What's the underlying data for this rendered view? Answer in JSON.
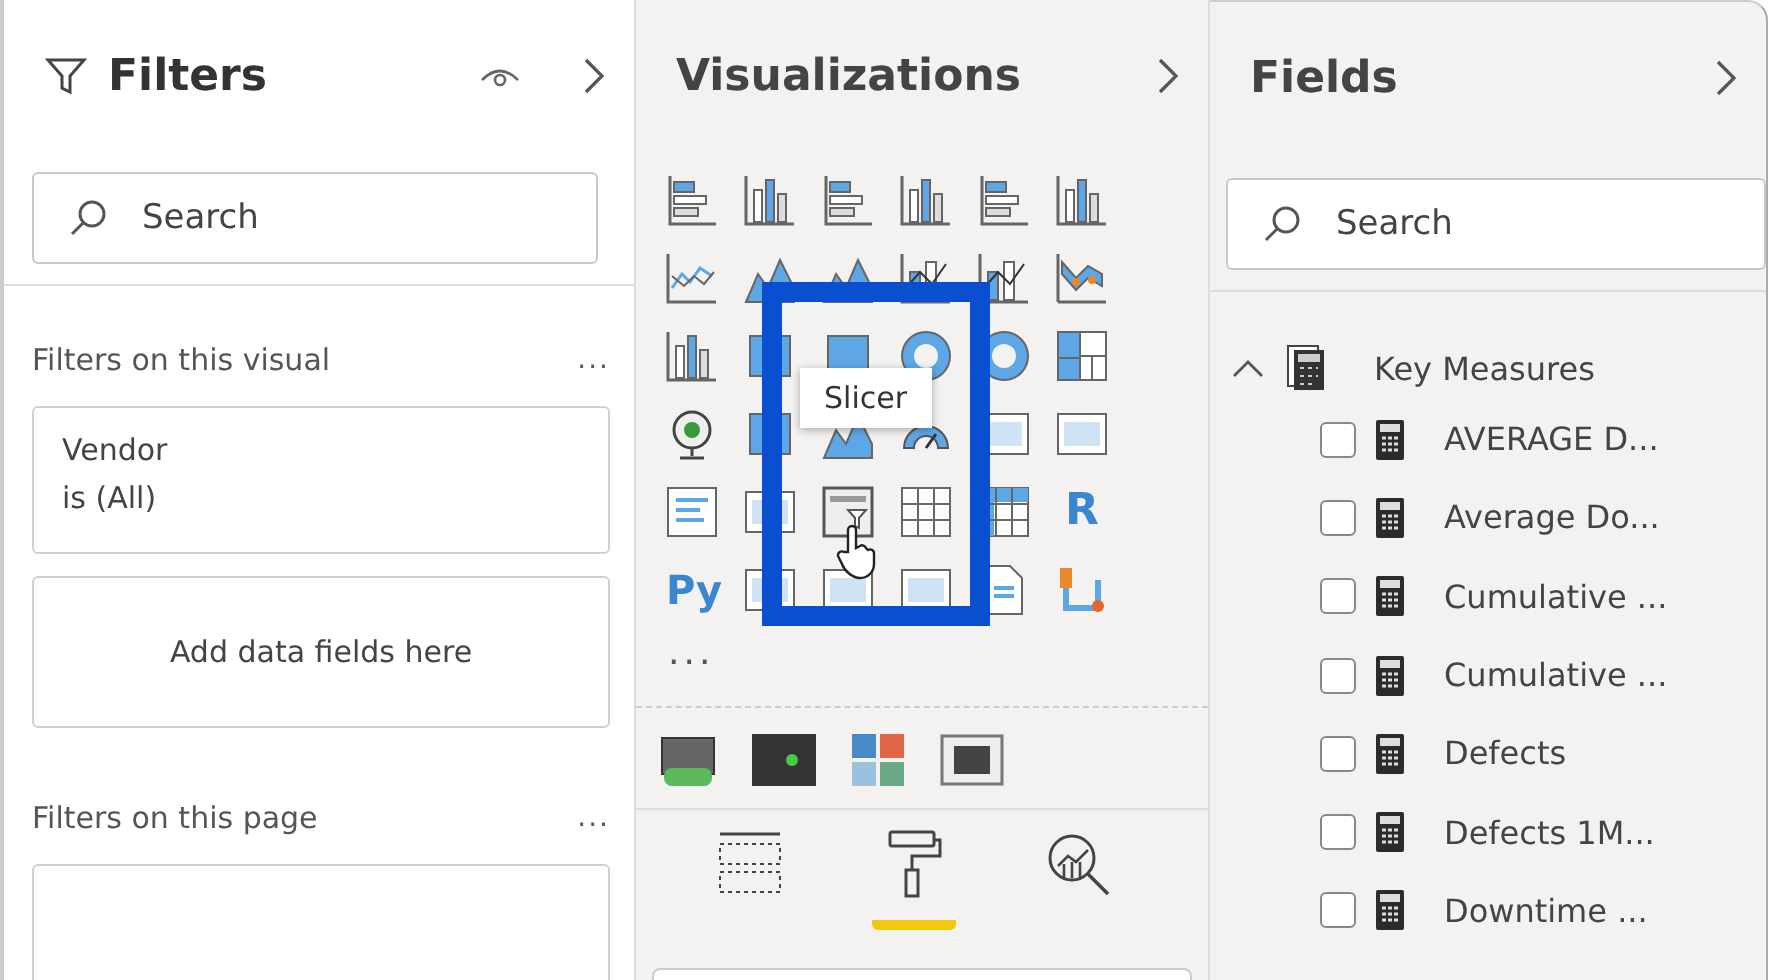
{
  "filters": {
    "title": "Filters",
    "search": {
      "placeholder": "Search"
    },
    "sections": [
      {
        "heading": "Filters on this visual",
        "more": "...",
        "cards": [
          {
            "kind": "filter",
            "field": "Vendor",
            "condition": "is (All)"
          },
          {
            "kind": "drop",
            "text": "Add data fields here"
          }
        ]
      },
      {
        "heading": "Filters on this page",
        "more": "...",
        "cards": [
          {
            "kind": "drop"
          }
        ]
      }
    ]
  },
  "visualizations": {
    "title": "Visualizations",
    "script_labels": [
      "R",
      "Py"
    ],
    "more": "...",
    "tooltip": "Slicer",
    "pane_tabs": [
      {
        "kind": "build",
        "selected": false
      },
      {
        "kind": "format",
        "selected": true
      },
      {
        "kind": "analytics",
        "selected": false
      }
    ]
  },
  "fields": {
    "title": "Fields",
    "search": {
      "placeholder": "Search"
    },
    "tree": [
      {
        "label": "Key Measures",
        "expanded": true,
        "children": [
          {
            "label": "AVERAGE D...",
            "checked": false
          },
          {
            "label": "Average Do...",
            "checked": false
          },
          {
            "label": "Cumulative ...",
            "checked": false
          },
          {
            "label": "Cumulative ...",
            "checked": false
          },
          {
            "label": "Defects",
            "checked": false
          },
          {
            "label": "Defects 1M...",
            "checked": false
          },
          {
            "label": "Downtime ...",
            "checked": false
          }
        ]
      }
    ]
  }
}
